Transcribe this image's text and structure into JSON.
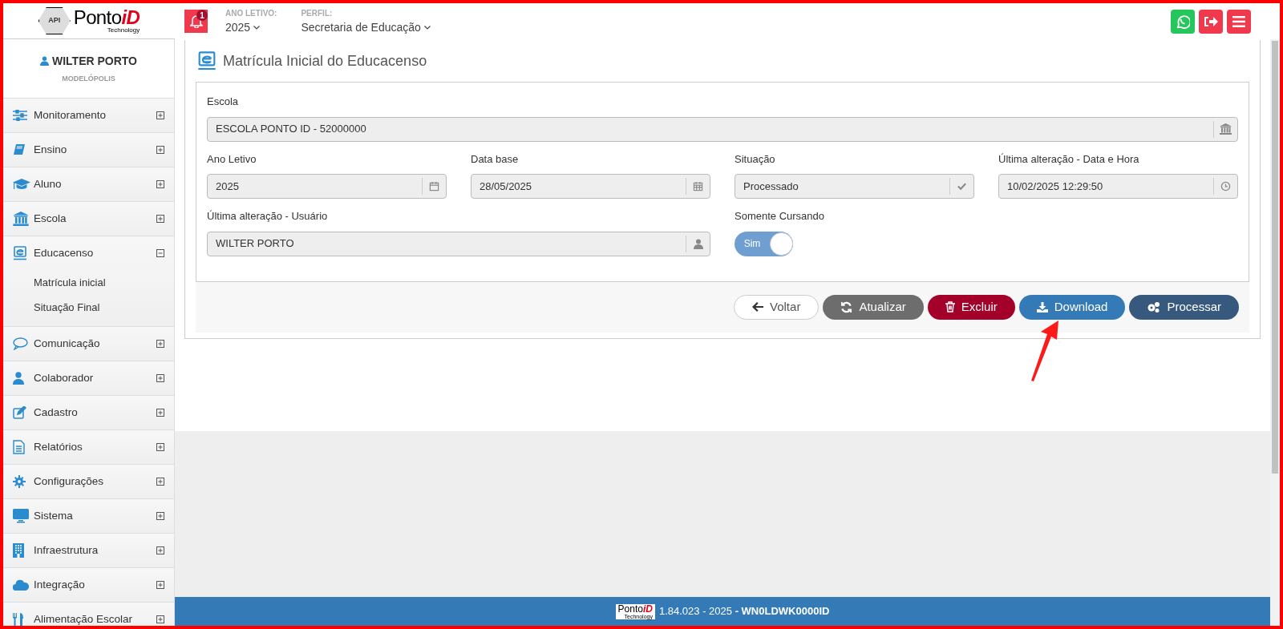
{
  "header": {
    "logo": {
      "badge": "API",
      "brand": "Ponto",
      "brand_accent": "iD",
      "tagline": "Technology"
    },
    "notifications": {
      "count": "1"
    },
    "year": {
      "label": "ANO LETIVO:",
      "value": "2025"
    },
    "profile": {
      "label": "PERFIL:",
      "value": "Secretaria de Educação"
    }
  },
  "sidebar": {
    "user": {
      "name": "WILTER PORTO",
      "city": "MODELÓPOLIS"
    },
    "items": [
      {
        "label": "Monitoramento",
        "expanded": false
      },
      {
        "label": "Ensino",
        "expanded": false
      },
      {
        "label": "Aluno",
        "expanded": false
      },
      {
        "label": "Escola",
        "expanded": false
      },
      {
        "label": "Educacenso",
        "expanded": true,
        "children": [
          {
            "label": "Matrícula inicial"
          },
          {
            "label": "Situação Final"
          }
        ]
      },
      {
        "label": "Comunicação",
        "expanded": false
      },
      {
        "label": "Colaborador",
        "expanded": false
      },
      {
        "label": "Cadastro",
        "expanded": false
      },
      {
        "label": "Relatórios",
        "expanded": false
      },
      {
        "label": "Configurações",
        "expanded": false
      },
      {
        "label": "Sistema",
        "expanded": false
      },
      {
        "label": "Infraestrutura",
        "expanded": false
      },
      {
        "label": "Integração",
        "expanded": false
      },
      {
        "label": "Alimentação Escolar",
        "expanded": false
      }
    ]
  },
  "page": {
    "title": "Matrícula Inicial do Educacenso",
    "escola": {
      "label": "Escola",
      "value": "ESCOLA PONTO ID - 52000000"
    },
    "fields": [
      {
        "label": "Ano Letivo",
        "value": "2025"
      },
      {
        "label": "Data base",
        "value": "28/05/2025"
      },
      {
        "label": "Situação",
        "value": "Processado"
      },
      {
        "label": "Última alteração - Data e Hora",
        "value": "10/02/2025 12:29:50"
      }
    ],
    "usuario": {
      "label": "Última alteração - Usuário",
      "value": "WILTER PORTO"
    },
    "toggle": {
      "label": "Somente Cursando",
      "on": true,
      "text": "Sim"
    },
    "buttons": [
      {
        "label": "Voltar",
        "kind": "outline"
      },
      {
        "label": "Atualizar",
        "kind": "gray"
      },
      {
        "label": "Excluir",
        "kind": "danger"
      },
      {
        "label": "Download",
        "kind": "primary"
      },
      {
        "label": "Processar",
        "kind": "dark"
      }
    ]
  },
  "footer": {
    "logo_brand": "Ponto",
    "logo_accent": "iD",
    "logo_tagline": "Technology",
    "version": "1.84.023 - 2025",
    "code": "- WN0LDWK0000ID"
  }
}
